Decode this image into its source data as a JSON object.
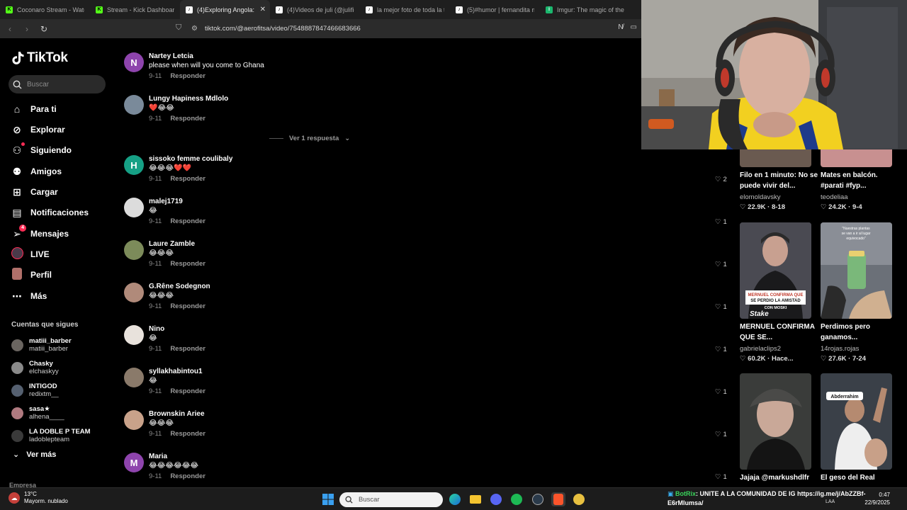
{
  "browser": {
    "tabs": [
      {
        "title": "Coconaro Stream - Watch",
        "icon": "kick",
        "active": false
      },
      {
        "title": "Stream - Kick Dashboard",
        "icon": "kick",
        "active": false
      },
      {
        "title": "(4)Exploring Angola:",
        "icon": "tiktok",
        "active": true
      },
      {
        "title": "(4)Videos de juli (@julifio",
        "icon": "tiktok",
        "active": false
      },
      {
        "title": "la mejor foto de toda la tr",
        "icon": "tiktok",
        "active": false
      },
      {
        "title": "(5)#humor | fernandita mo",
        "icon": "tiktok",
        "active": false
      },
      {
        "title": "Imgur: The magic of the In",
        "icon": "imgur",
        "active": false
      }
    ],
    "url": "tiktok.com/@aerofitsa/video/7548887847466683666"
  },
  "sidebar": {
    "logo": "TikTok",
    "search_placeholder": "Buscar",
    "nav": [
      {
        "label": "Para ti",
        "icon": "home-icon"
      },
      {
        "label": "Explorar",
        "icon": "compass-icon"
      },
      {
        "label": "Siguiendo",
        "icon": "following-icon"
      },
      {
        "label": "Amigos",
        "icon": "friends-icon"
      },
      {
        "label": "Cargar",
        "icon": "upload-icon"
      },
      {
        "label": "Notificaciones",
        "icon": "inbox-icon"
      },
      {
        "label": "Mensajes",
        "icon": "send-icon",
        "badge": "4"
      },
      {
        "label": "LIVE",
        "icon": "live-icon"
      },
      {
        "label": "Perfil",
        "icon": "profile-icon"
      },
      {
        "label": "Más",
        "icon": "more-icon"
      }
    ],
    "following_title": "Cuentas que sigues",
    "following": [
      {
        "name": "matiii_barber",
        "handle": "matiii_barber"
      },
      {
        "name": "Chasky",
        "handle": "elchaskyy"
      },
      {
        "name": "INTIGOD",
        "handle": "redixtm__"
      },
      {
        "name": "sasa★",
        "handle": "alhena____"
      },
      {
        "name": "LA DOBLE P TEAM",
        "handle": "ladoblepteam"
      }
    ],
    "see_more": "Ver más",
    "company": "Empresa"
  },
  "comments": {
    "reply_label": "Responder",
    "view_replies": "Ver 1 respuesta",
    "items": [
      {
        "name": "Nartey Letcia",
        "text": "please when will you come to Ghana",
        "date": "9-11",
        "initial": "N",
        "color": "#8e44ad"
      },
      {
        "name": "Lungy Hapiness Mdlolo",
        "text": "❤️😂😂",
        "date": "9-11",
        "initial": "",
        "color": "#7a8a9a"
      },
      {
        "name": "sissoko femme coulibaly",
        "text": "😂😂😂❤️❤️",
        "date": "9-11",
        "initial": "H",
        "color": "#16a085"
      },
      {
        "name": "malej1719",
        "text": "😂",
        "date": "9-11",
        "initial": "",
        "color": "#dcdcdc"
      },
      {
        "name": "Laure Zamble",
        "text": "😂😂😂",
        "date": "9-11",
        "initial": "",
        "color": "#7c8b5a"
      },
      {
        "name": "G.Rêne Sodegnon",
        "text": "😂😂😂",
        "date": "9-11",
        "initial": "",
        "color": "#b08a7a"
      },
      {
        "name": "Nino",
        "text": "😂",
        "date": "9-11",
        "initial": "",
        "color": "#e8e2dc"
      },
      {
        "name": "syllakhabintou1",
        "text": "😂",
        "date": "9-11",
        "initial": "",
        "color": "#8a7a6a"
      },
      {
        "name": "Brownskin Ariee",
        "text": "😂😂😂",
        "date": "9-11",
        "initial": "",
        "color": "#c9a28a"
      },
      {
        "name": "Maria",
        "text": "😂😂😂😂😂😂",
        "date": "9-11",
        "initial": "M",
        "color": "#8e44ad"
      }
    ]
  },
  "likes": [
    "2",
    "1",
    "1",
    "1",
    "1",
    "1",
    "1",
    "1"
  ],
  "videos": [
    {
      "title": "Filo en 1 minuto: No se puede vivir del...",
      "user": "elomoldavsky",
      "views": "22.9K",
      "date": "8-18"
    },
    {
      "title": "Mates en balcón. #parati #fyp...",
      "user": "teodeliaa",
      "views": "24.2K",
      "date": "9-4"
    },
    {
      "title": "MERNUEL CONFIRMA QUE SE...",
      "user": "gabrielaclips2",
      "views": "60.2K",
      "date": "Hace...",
      "overlay": "MERNUEL CONFIRMA QUE SE PERDIO LA AMISTAD CON MOSKI"
    },
    {
      "title": "Perdimos pero ganamos...",
      "user": "14rojas.rojas",
      "views": "27.6K",
      "date": "7-24",
      "overlay": "\"Nuestras plantas se van a ir al lugar equivocado\""
    },
    {
      "title": "Jajaja @markushdlfr",
      "user": "",
      "views": "",
      "date": ""
    },
    {
      "title": "El geso del Real",
      "user": "",
      "views": "",
      "date": "",
      "overlay": "Abderrahim😅"
    }
  ],
  "taskbar": {
    "weather_temp": "13°C",
    "weather_desc": "Mayorm. nublado",
    "search_placeholder": "Buscar",
    "ticker_bot": "BotRix",
    "ticker_text": ": UNITE A LA COMUNIDAD DE IG https://ig.me/j/AbZZBf-E6rMlumsa/",
    "lang": "LAA",
    "time": "0:47",
    "date": "22/9/2025"
  }
}
